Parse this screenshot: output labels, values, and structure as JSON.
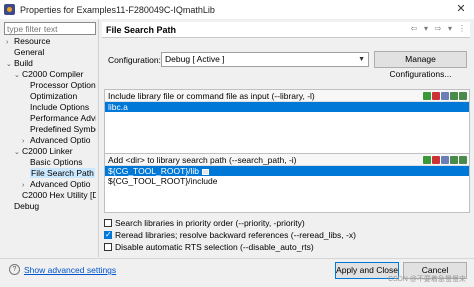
{
  "window": {
    "title": "Properties for Examples11-F280049C-IQmathLib"
  },
  "filter": {
    "placeholder": "type filter text"
  },
  "tree": [
    {
      "label": "Resource",
      "toggle": "›"
    },
    {
      "label": "General",
      "toggle": ""
    },
    {
      "label": "Build",
      "toggle": "⌄"
    },
    {
      "label": "C2000 Compiler",
      "toggle": "⌄"
    },
    {
      "label": "Processor Options",
      "toggle": ""
    },
    {
      "label": "Optimization",
      "toggle": ""
    },
    {
      "label": "Include Options",
      "toggle": ""
    },
    {
      "label": "Performance Advi",
      "toggle": ""
    },
    {
      "label": "Predefined Symbo",
      "toggle": ""
    },
    {
      "label": "Advanced Optio",
      "toggle": "›"
    },
    {
      "label": "C2000 Linker",
      "toggle": "⌄"
    },
    {
      "label": "Basic Options",
      "toggle": ""
    },
    {
      "label": "File Search Path",
      "toggle": ""
    },
    {
      "label": "Advanced Optio",
      "toggle": "›"
    },
    {
      "label": "C2000 Hex Utility  [D",
      "toggle": ""
    },
    {
      "label": "Debug",
      "toggle": ""
    }
  ],
  "page": {
    "title": "File Search Path",
    "nav": [
      "⇦",
      "▾",
      "⇨",
      "▾",
      "⋮"
    ]
  },
  "configuration": {
    "label": "Configuration:",
    "value": "Debug  [ Active ]",
    "manage_label": "Manage Configurations..."
  },
  "library_group": {
    "title": "Include library file or command file as input (--library, -l)",
    "items": [
      "libc.a"
    ]
  },
  "search_path_group": {
    "title": "Add <dir> to library search path (--search_path, -i)",
    "items": [
      "${CG_TOOL_ROOT}/lib",
      "${CG_TOOL_ROOT}/include"
    ]
  },
  "options": [
    {
      "label": "Search libraries in priority order (--priority, -priority)",
      "checked": false
    },
    {
      "label": "Reread libraries; resolve backward references (--reread_libs, -x)",
      "checked": true
    },
    {
      "label": "Disable automatic RTS selection (--disable_auto_rts)",
      "checked": false
    }
  ],
  "footer": {
    "advanced_link": "Show advanced settings",
    "apply_close": "Apply and Close",
    "cancel": "Cancel",
    "watermark": "CSDN @不要着急慢慢来"
  }
}
